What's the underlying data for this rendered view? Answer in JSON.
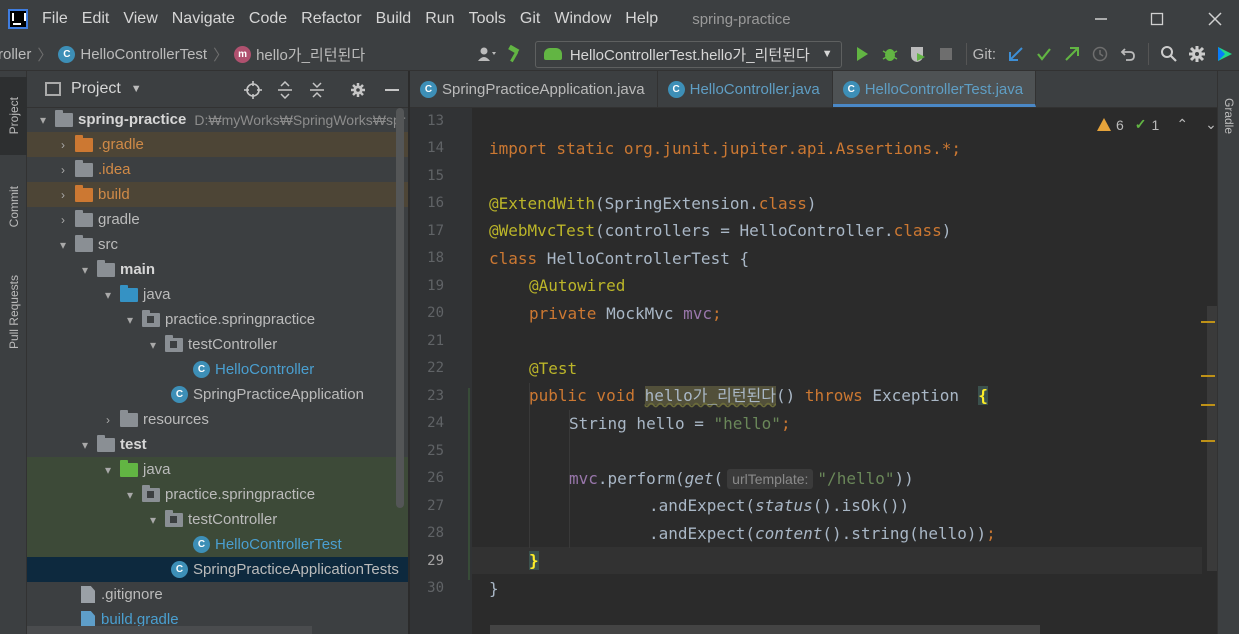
{
  "menubar": {
    "items": [
      "File",
      "Edit",
      "View",
      "Navigate",
      "Code",
      "Refactor",
      "Build",
      "Run",
      "Tools",
      "Git",
      "Window",
      "Help"
    ],
    "window_title": "spring-practice",
    "controls": [
      "minimize-icon",
      "maximize-icon",
      "close-icon"
    ]
  },
  "navbar": {
    "crumbs": [
      "roller",
      "HelloControllerTest",
      "hello가_리턴된다"
    ],
    "run_config": "HelloControllerTest.hello가_리턴된다",
    "git_label": "Git:"
  },
  "left_stripe": {
    "project": "Project",
    "commit": "Commit",
    "pull_requests": "Pull Requests"
  },
  "right_stripe": {
    "gradle": "Gradle"
  },
  "project_panel": {
    "title": "Project",
    "tree": [
      {
        "label": "spring-practice",
        "path": "D:₩myWorks₩SpringWorks₩spr"
      },
      {
        "label": ".gradle"
      },
      {
        "label": ".idea"
      },
      {
        "label": "build"
      },
      {
        "label": "gradle"
      },
      {
        "label": "src"
      },
      {
        "label": "main"
      },
      {
        "label": "java"
      },
      {
        "label": "practice.springpractice"
      },
      {
        "label": "testController"
      },
      {
        "label": "HelloController"
      },
      {
        "label": "SpringPracticeApplication"
      },
      {
        "label": "resources"
      },
      {
        "label": "test"
      },
      {
        "label": "java"
      },
      {
        "label": "practice.springpractice"
      },
      {
        "label": "testController"
      },
      {
        "label": "HelloControllerTest"
      },
      {
        "label": "SpringPracticeApplicationTests"
      },
      {
        "label": ".gitignore"
      },
      {
        "label": "build.gradle"
      }
    ]
  },
  "editor": {
    "tabs": [
      "SpringPracticeApplication.java",
      "HelloController.java",
      "HelloControllerTest.java"
    ],
    "active_tab": "HelloControllerTest.java",
    "warnings_count": "6",
    "ok_count": "1",
    "line_numbers": [
      "13",
      "14",
      "15",
      "16",
      "17",
      "18",
      "19",
      "20",
      "21",
      "22",
      "23",
      "24",
      "25",
      "26",
      "27",
      "28",
      "29",
      "30"
    ],
    "current_line": "29",
    "code": {
      "l14": "import static org.junit.jupiter.api.Assertions.*;",
      "l16_a": "@ExtendWith",
      "l16_b": "(SpringExtension.",
      "l16_c": "class",
      "l16_d": ")",
      "l17_a": "@WebMvcTest",
      "l17_b": "(controllers = HelloController.",
      "l17_c": "class",
      "l17_d": ")",
      "l18_a": "class",
      "l18_b": " HelloControllerTest {",
      "l19": "@Autowired",
      "l20_a": "private",
      "l20_b": " MockMvc ",
      "l20_c": "mvc",
      "l20_d": ";",
      "l22": "@Test",
      "l23_a": "public void ",
      "l23_b": "hello가_리턴된다",
      "l23_c": "() ",
      "l23_d": "throws",
      "l23_e": " Exception  ",
      "l23_f": "{",
      "l24_a": "String hello = ",
      "l24_b": "\"hello\"",
      "l24_c": ";",
      "l26_a": "mvc",
      "l26_b": ".perform(",
      "l26_c": "get",
      "l26_d": "(",
      "l26_hint": "urlTemplate:",
      "l26_e": "\"/hello\"",
      "l26_f": "))",
      "l27_a": ".andExpect(",
      "l27_b": "status",
      "l27_c": "().isOk())",
      "l28_a": ".andExpect(",
      "l28_b": "content",
      "l28_c": "().string(hello))",
      "l28_d": ";",
      "l29": "}",
      "l30": "}"
    }
  },
  "colors": {
    "keyword": "#cc7832",
    "annotation": "#bbb529",
    "string": "#6a8759",
    "field": "#9876aa",
    "accent": "#4a88c7"
  }
}
